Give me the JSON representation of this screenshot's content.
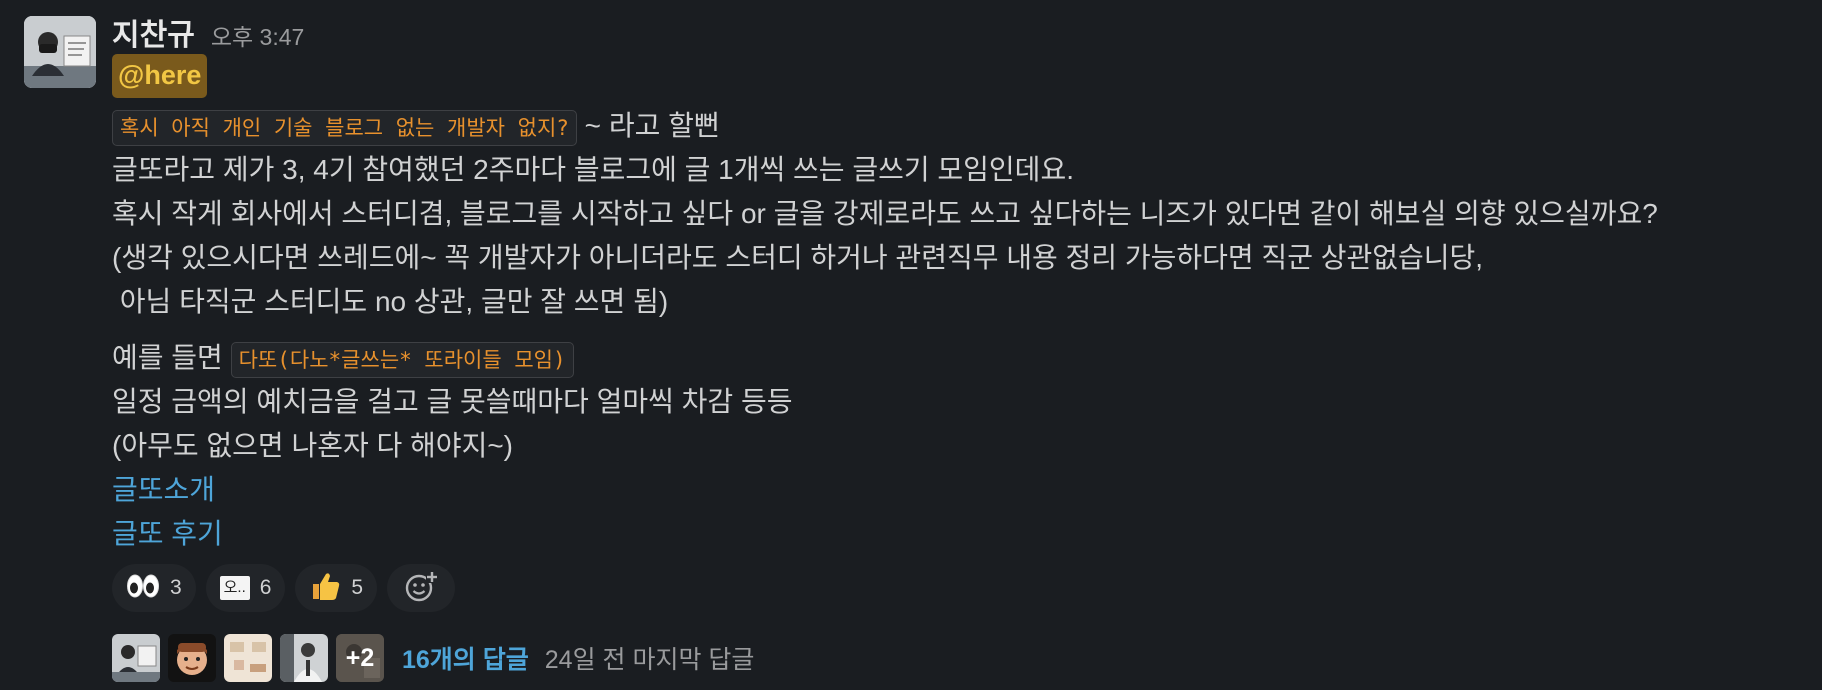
{
  "message": {
    "sender": "지찬규",
    "time": "오후 3:47",
    "mention": "@here",
    "line1_code": "혹시 아직 개인 기술 블로그 없는 개발자 없지?",
    "line1_rest": " ~ 라고 할뻔",
    "lines": [
      "글또라고 제가 3, 4기 참여했던 2주마다 블로그에 글 1개씩 쓰는 글쓰기 모임인데요.",
      "혹시 작게 회사에서 스터디겸, 블로그를 시작하고 싶다 or 글을 강제로라도 쓰고 싶다하는 니즈가 있다면 같이 해보실 의향 있으실까요?",
      "(생각 있으시다면 쓰레드에~ 꼭 개발자가 아니더라도 스터디 하거나 관련직무 내용 정리 가능하다면 직군 상관없습니당,",
      " 아님 타직군 스터디도 no 상관, 글만 잘 쓰면 됨)"
    ],
    "example_prefix": "예를 들면 ",
    "example_code": "다또(다노*글쓰는* 또라이들 모임)",
    "lines2": [
      "일정 금액의 예치금을 걸고 글 못쓸때마다 얼마씩 차감 등등",
      "(아무도 없으면 나혼자 다 해야지~)"
    ],
    "links": [
      "글또소개",
      "글또 후기"
    ]
  },
  "reactions": [
    {
      "icon": "eyes-icon",
      "glyph": "👀",
      "count": "3"
    },
    {
      "icon": "custom-o-emoji-icon",
      "glyph": "오..",
      "count": "6"
    },
    {
      "icon": "thumbs-up-icon",
      "glyph": "👍",
      "count": "5"
    }
  ],
  "thread": {
    "more_avatars": "+2",
    "replies": "16개의 답글",
    "last_reply": "24일 전 마지막 답글"
  },
  "colors": {
    "background": "#1a1d21",
    "link": "#4ea5d9",
    "code_text": "#e8912d",
    "mention_bg": "#7a5a1c",
    "mention_text": "#f2c744"
  }
}
